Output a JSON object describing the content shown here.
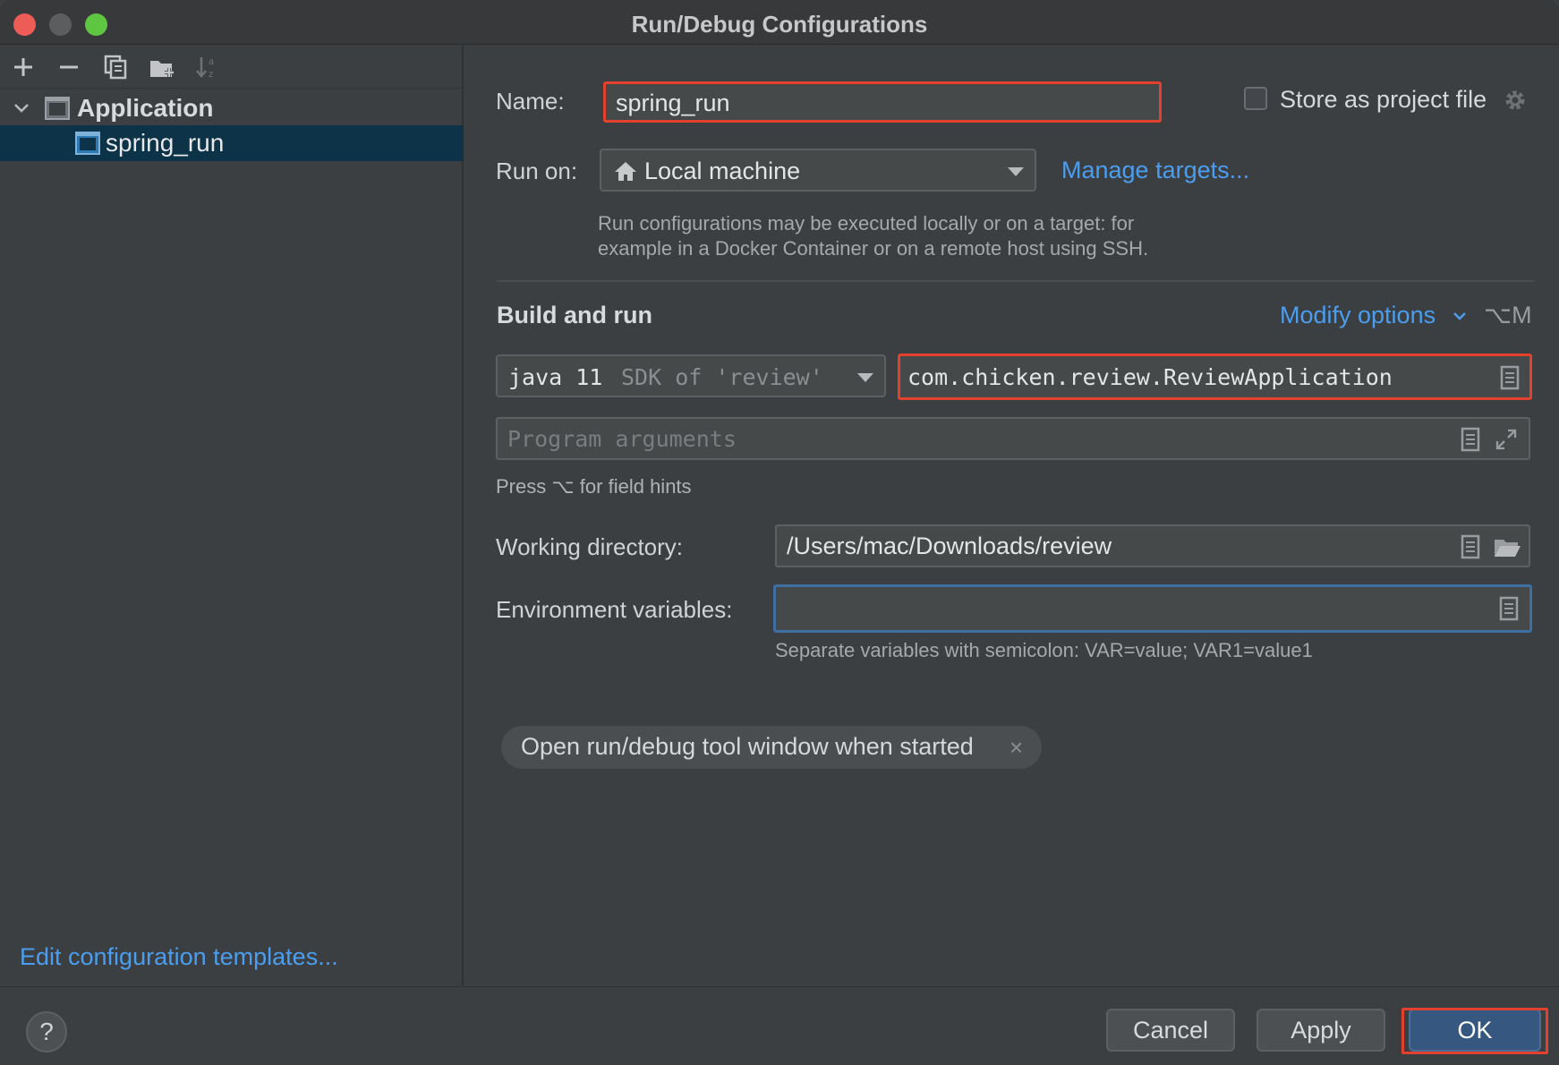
{
  "window": {
    "title": "Run/Debug Configurations"
  },
  "toolbar": {
    "icons": [
      "add-icon",
      "remove-icon",
      "copy-icon",
      "new-folder-icon",
      "sort-icon"
    ]
  },
  "tree": {
    "group_label": "Application",
    "child_label": "spring_run"
  },
  "sidebar": {
    "edit_templates_link": "Edit configuration templates..."
  },
  "form": {
    "name_label": "Name:",
    "name_value": "spring_run",
    "store_label": "Store as project file",
    "run_on_label": "Run on:",
    "run_on_value": "Local machine",
    "manage_targets": "Manage targets...",
    "run_on_hint_line1": "Run configurations may be executed locally or on a target: for",
    "run_on_hint_line2": "example in a Docker Container or on a remote host using SSH.",
    "section_title": "Build and run",
    "modify_options": "Modify options",
    "modify_shortcut": "⌥M",
    "sdk_main": "java 11",
    "sdk_sub": "SDK of 'review'",
    "main_class": "com.chicken.review.ReviewApplication",
    "program_args_placeholder": "Program arguments",
    "field_hints": "Press ⌥ for field hints",
    "working_dir_label": "Working directory:",
    "working_dir_value": "/Users/mac/Downloads/review",
    "env_label": "Environment variables:",
    "env_value": "",
    "env_hint": "Separate variables with semicolon: VAR=value; VAR1=value1",
    "chip_label": "Open run/debug tool window when started",
    "chip_close": "×"
  },
  "buttons": {
    "help": "?",
    "cancel": "Cancel",
    "apply": "Apply",
    "ok": "OK"
  },
  "colors": {
    "accent_link": "#4b9eef",
    "highlight": "#e3402d",
    "selection": "#0d3349",
    "ok_button": "#365880"
  }
}
